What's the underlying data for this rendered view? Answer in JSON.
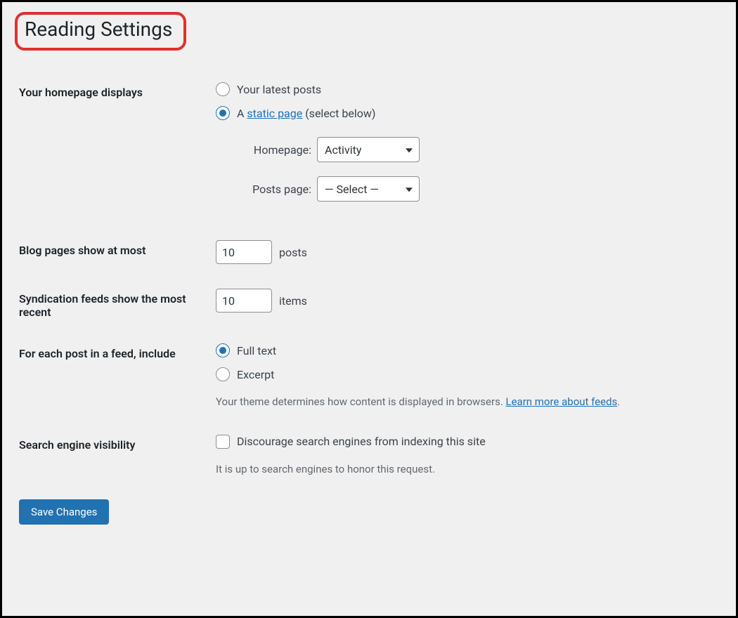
{
  "page_title": "Reading Settings",
  "sections": {
    "homepage": {
      "label": "Your homepage displays",
      "option_latest": "Your latest posts",
      "option_static_prefix": "A ",
      "option_static_link": "static page",
      "option_static_suffix": " (select below)",
      "homepage_label": "Homepage:",
      "homepage_value": "Activity",
      "posts_page_label": "Posts page:",
      "posts_page_value": "— Select —"
    },
    "blog_pages": {
      "label": "Blog pages show at most",
      "value": "10",
      "suffix": "posts"
    },
    "syndication": {
      "label": "Syndication feeds show the most recent",
      "value": "10",
      "suffix": "items"
    },
    "feed_content": {
      "label": "For each post in a feed, include",
      "option_full": "Full text",
      "option_excerpt": "Excerpt",
      "description_prefix": "Your theme determines how content is displayed in browsers. ",
      "description_link": "Learn more about feeds",
      "description_suffix": "."
    },
    "search_visibility": {
      "label": "Search engine visibility",
      "checkbox_label": "Discourage search engines from indexing this site",
      "description": "It is up to search engines to honor this request."
    }
  },
  "save_button": "Save Changes"
}
